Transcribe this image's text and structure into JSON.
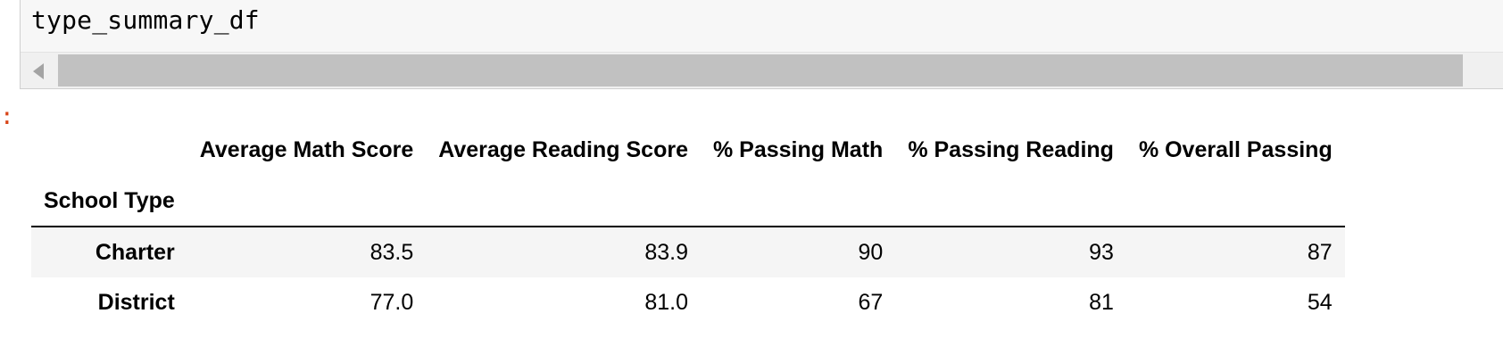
{
  "input_cell": {
    "code": "type_summary_df"
  },
  "output_prompt": ":",
  "dataframe": {
    "index_name": "School Type",
    "columns": [
      "Average Math Score",
      "Average Reading Score",
      "% Passing Math",
      "% Passing Reading",
      "% Overall Passing"
    ],
    "rows": [
      {
        "index": "Charter",
        "values": [
          "83.5",
          "83.9",
          "90",
          "93",
          "87"
        ]
      },
      {
        "index": "District",
        "values": [
          "77.0",
          "81.0",
          "67",
          "81",
          "54"
        ]
      }
    ]
  }
}
